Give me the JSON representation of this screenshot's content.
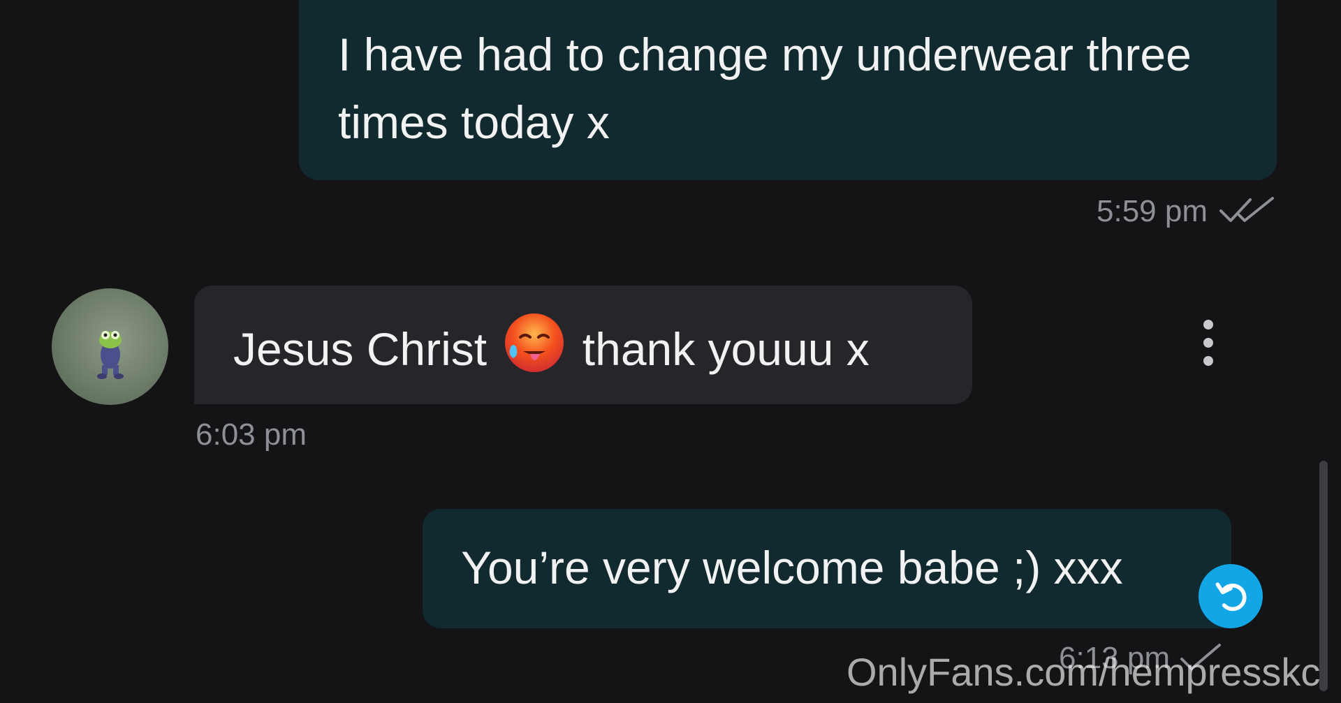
{
  "messages": [
    {
      "direction": "outgoing",
      "text": "I have had to change my underwear three times today x",
      "time": "5:59 pm",
      "status_icon": "double-check-icon"
    },
    {
      "direction": "incoming",
      "text_before_emoji": "Jesus Christ",
      "emoji": "🥵",
      "text_after_emoji": "thank youuu x",
      "time": "6:03 pm",
      "sender_avatar_icon": "frog-avatar"
    },
    {
      "direction": "outgoing",
      "text": "You’re very welcome babe ;) xxx",
      "time": "6:13 pm",
      "status_icon": "single-check-icon"
    }
  ],
  "actions": {
    "more_icon": "more-vertical-icon",
    "reply_icon": "undo-reply-icon"
  },
  "watermark": "OnlyFans.com/hempresskc",
  "colors": {
    "background": "#141416",
    "outgoing_bubble": "#112a30",
    "incoming_bubble": "#25252a",
    "timestamp": "#8d9096",
    "accent": "#12a6e6"
  }
}
